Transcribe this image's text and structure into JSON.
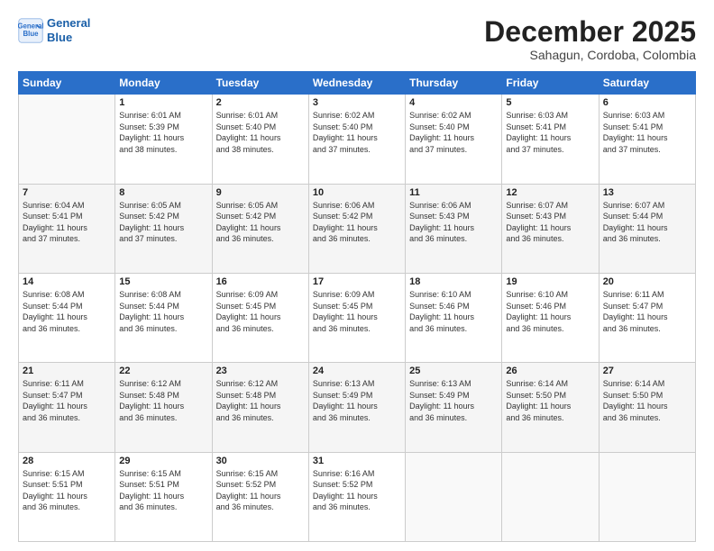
{
  "logo": {
    "line1": "General",
    "line2": "Blue"
  },
  "title": "December 2025",
  "subtitle": "Sahagun, Cordoba, Colombia",
  "weekdays": [
    "Sunday",
    "Monday",
    "Tuesday",
    "Wednesday",
    "Thursday",
    "Friday",
    "Saturday"
  ],
  "weeks": [
    [
      {
        "day": "",
        "info": ""
      },
      {
        "day": "1",
        "info": "Sunrise: 6:01 AM\nSunset: 5:39 PM\nDaylight: 11 hours\nand 38 minutes."
      },
      {
        "day": "2",
        "info": "Sunrise: 6:01 AM\nSunset: 5:40 PM\nDaylight: 11 hours\nand 38 minutes."
      },
      {
        "day": "3",
        "info": "Sunrise: 6:02 AM\nSunset: 5:40 PM\nDaylight: 11 hours\nand 37 minutes."
      },
      {
        "day": "4",
        "info": "Sunrise: 6:02 AM\nSunset: 5:40 PM\nDaylight: 11 hours\nand 37 minutes."
      },
      {
        "day": "5",
        "info": "Sunrise: 6:03 AM\nSunset: 5:41 PM\nDaylight: 11 hours\nand 37 minutes."
      },
      {
        "day": "6",
        "info": "Sunrise: 6:03 AM\nSunset: 5:41 PM\nDaylight: 11 hours\nand 37 minutes."
      }
    ],
    [
      {
        "day": "7",
        "info": "Sunrise: 6:04 AM\nSunset: 5:41 PM\nDaylight: 11 hours\nand 37 minutes."
      },
      {
        "day": "8",
        "info": "Sunrise: 6:05 AM\nSunset: 5:42 PM\nDaylight: 11 hours\nand 37 minutes."
      },
      {
        "day": "9",
        "info": "Sunrise: 6:05 AM\nSunset: 5:42 PM\nDaylight: 11 hours\nand 36 minutes."
      },
      {
        "day": "10",
        "info": "Sunrise: 6:06 AM\nSunset: 5:42 PM\nDaylight: 11 hours\nand 36 minutes."
      },
      {
        "day": "11",
        "info": "Sunrise: 6:06 AM\nSunset: 5:43 PM\nDaylight: 11 hours\nand 36 minutes."
      },
      {
        "day": "12",
        "info": "Sunrise: 6:07 AM\nSunset: 5:43 PM\nDaylight: 11 hours\nand 36 minutes."
      },
      {
        "day": "13",
        "info": "Sunrise: 6:07 AM\nSunset: 5:44 PM\nDaylight: 11 hours\nand 36 minutes."
      }
    ],
    [
      {
        "day": "14",
        "info": "Sunrise: 6:08 AM\nSunset: 5:44 PM\nDaylight: 11 hours\nand 36 minutes."
      },
      {
        "day": "15",
        "info": "Sunrise: 6:08 AM\nSunset: 5:44 PM\nDaylight: 11 hours\nand 36 minutes."
      },
      {
        "day": "16",
        "info": "Sunrise: 6:09 AM\nSunset: 5:45 PM\nDaylight: 11 hours\nand 36 minutes."
      },
      {
        "day": "17",
        "info": "Sunrise: 6:09 AM\nSunset: 5:45 PM\nDaylight: 11 hours\nand 36 minutes."
      },
      {
        "day": "18",
        "info": "Sunrise: 6:10 AM\nSunset: 5:46 PM\nDaylight: 11 hours\nand 36 minutes."
      },
      {
        "day": "19",
        "info": "Sunrise: 6:10 AM\nSunset: 5:46 PM\nDaylight: 11 hours\nand 36 minutes."
      },
      {
        "day": "20",
        "info": "Sunrise: 6:11 AM\nSunset: 5:47 PM\nDaylight: 11 hours\nand 36 minutes."
      }
    ],
    [
      {
        "day": "21",
        "info": "Sunrise: 6:11 AM\nSunset: 5:47 PM\nDaylight: 11 hours\nand 36 minutes."
      },
      {
        "day": "22",
        "info": "Sunrise: 6:12 AM\nSunset: 5:48 PM\nDaylight: 11 hours\nand 36 minutes."
      },
      {
        "day": "23",
        "info": "Sunrise: 6:12 AM\nSunset: 5:48 PM\nDaylight: 11 hours\nand 36 minutes."
      },
      {
        "day": "24",
        "info": "Sunrise: 6:13 AM\nSunset: 5:49 PM\nDaylight: 11 hours\nand 36 minutes."
      },
      {
        "day": "25",
        "info": "Sunrise: 6:13 AM\nSunset: 5:49 PM\nDaylight: 11 hours\nand 36 minutes."
      },
      {
        "day": "26",
        "info": "Sunrise: 6:14 AM\nSunset: 5:50 PM\nDaylight: 11 hours\nand 36 minutes."
      },
      {
        "day": "27",
        "info": "Sunrise: 6:14 AM\nSunset: 5:50 PM\nDaylight: 11 hours\nand 36 minutes."
      }
    ],
    [
      {
        "day": "28",
        "info": "Sunrise: 6:15 AM\nSunset: 5:51 PM\nDaylight: 11 hours\nand 36 minutes."
      },
      {
        "day": "29",
        "info": "Sunrise: 6:15 AM\nSunset: 5:51 PM\nDaylight: 11 hours\nand 36 minutes."
      },
      {
        "day": "30",
        "info": "Sunrise: 6:15 AM\nSunset: 5:52 PM\nDaylight: 11 hours\nand 36 minutes."
      },
      {
        "day": "31",
        "info": "Sunrise: 6:16 AM\nSunset: 5:52 PM\nDaylight: 11 hours\nand 36 minutes."
      },
      {
        "day": "",
        "info": ""
      },
      {
        "day": "",
        "info": ""
      },
      {
        "day": "",
        "info": ""
      }
    ]
  ]
}
